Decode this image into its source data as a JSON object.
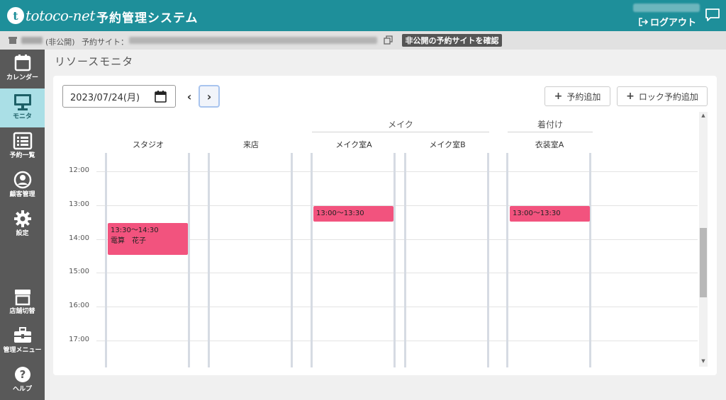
{
  "header": {
    "logo_text": "totoco-net",
    "app_title": "予約管理システム",
    "logout_label": "ログアウト"
  },
  "subbar": {
    "private_label": "(非公開)",
    "site_label": "予約サイト：",
    "confirm_button": "非公開の予約サイトを確認"
  },
  "sidebar": {
    "items": [
      {
        "label": "カレンダー",
        "icon": "calendar-icon"
      },
      {
        "label": "モニタ",
        "icon": "monitor-icon",
        "active": true
      },
      {
        "label": "予約一覧",
        "icon": "list-icon"
      },
      {
        "label": "顧客管理",
        "icon": "user-icon"
      },
      {
        "label": "設定",
        "icon": "gear-icon"
      },
      {
        "label": "店舗切替",
        "icon": "store-icon"
      },
      {
        "label": "管理メニュー",
        "icon": "toolbox-icon"
      },
      {
        "label": "ヘルプ",
        "icon": "help-icon"
      }
    ]
  },
  "main": {
    "title": "リソースモニタ",
    "date_value": "2023/07/24(月)",
    "add_reservation": "予約追加",
    "add_lock_reservation": "ロック予約追加"
  },
  "schedule": {
    "groups": [
      "メイク",
      "着付け"
    ],
    "columns": [
      "スタジオ",
      "来店",
      "メイク室A",
      "メイク室B",
      "衣装室A"
    ],
    "times": [
      "12:00",
      "13:00",
      "14:00",
      "15:00",
      "16:00",
      "17:00"
    ],
    "appointments": [
      {
        "column": "スタジオ",
        "time": "13:30～14:30",
        "name": "電算　花子"
      },
      {
        "column": "メイク室A",
        "time": "13:00～13:30"
      },
      {
        "column": "衣装室A",
        "time": "13:00～13:30"
      }
    ]
  },
  "colors": {
    "header": "#1e8f9a",
    "sidebar": "#595959",
    "sidebar_active": "#aadfe6",
    "appointment": "#f2537e"
  }
}
